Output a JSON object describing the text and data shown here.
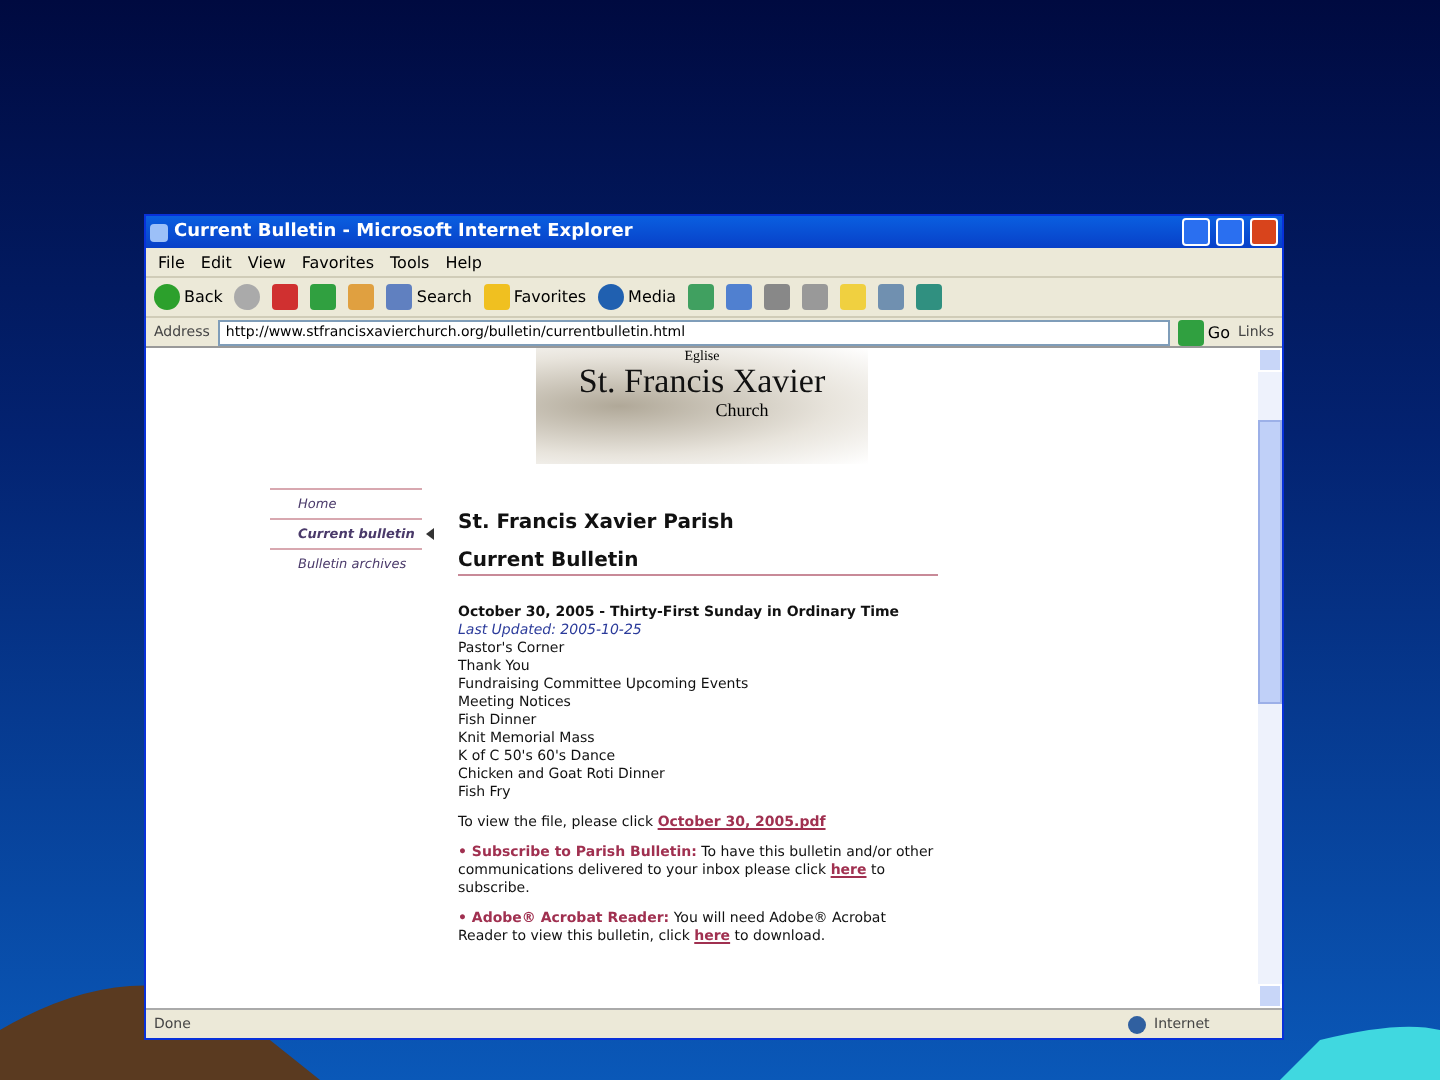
{
  "window": {
    "title": "Current Bulletin - Microsoft Internet Explorer"
  },
  "menu": [
    "File",
    "Edit",
    "View",
    "Favorites",
    "Tools",
    "Help"
  ],
  "toolbar": [
    {
      "kind": "back",
      "label": "Back"
    },
    {
      "kind": "forward"
    },
    {
      "kind": "stop"
    },
    {
      "kind": "refresh"
    },
    {
      "kind": "home"
    },
    {
      "kind": "search",
      "label": "Search"
    },
    {
      "kind": "favorites",
      "label": "Favorites"
    },
    {
      "kind": "media",
      "label": "Media"
    },
    {
      "kind": "history"
    },
    {
      "kind": "mail"
    },
    {
      "kind": "print"
    },
    {
      "kind": "edit"
    },
    {
      "kind": "folder"
    },
    {
      "kind": "research"
    },
    {
      "kind": "messenger"
    }
  ],
  "address": {
    "label": "Address",
    "value": "http://www.stfrancisxavierchurch.org/bulletin/currentbulletin.html",
    "go": "Go",
    "links": "Links"
  },
  "header": {
    "top": "Eglise",
    "name": "St. Francis Xavier",
    "sub": "Church"
  },
  "nav": [
    {
      "label": "Home",
      "selected": false
    },
    {
      "label": "Current bulletin",
      "selected": true
    },
    {
      "label": "Bulletin archives",
      "selected": false
    }
  ],
  "page": {
    "title": "St. Francis Xavier Parish",
    "section": "Current Bulletin",
    "issue": "October 30, 2005 - Thirty-First Sunday in Ordinary Time",
    "updated": "Last Updated: 2005-10-25",
    "items": [
      "Pastor's Corner",
      "Thank You",
      "Fundraising Committee Upcoming Events",
      "Meeting Notices",
      "Fish Dinner",
      "Knit Memorial Mass",
      "K of C 50's 60's Dance",
      "Chicken and Goat Roti Dinner",
      "Fish Fry"
    ],
    "view_text": "To view the file, please click",
    "view_link": "October 30, 2005.pdf",
    "notes": [
      {
        "bullet": "•",
        "head": "Subscribe to Parish Bulletin:",
        "before": "To have this bulletin and/or other communications delivered to your inbox please click",
        "link": "here",
        "after": "to subscribe."
      },
      {
        "bullet": "•",
        "head": "Adobe® Acrobat Reader:",
        "before": "You will need Adobe® Acrobat Reader to view this bulletin, click",
        "link": "here",
        "after": "to download."
      }
    ]
  },
  "status": {
    "text": "Done",
    "zone": "Internet"
  }
}
